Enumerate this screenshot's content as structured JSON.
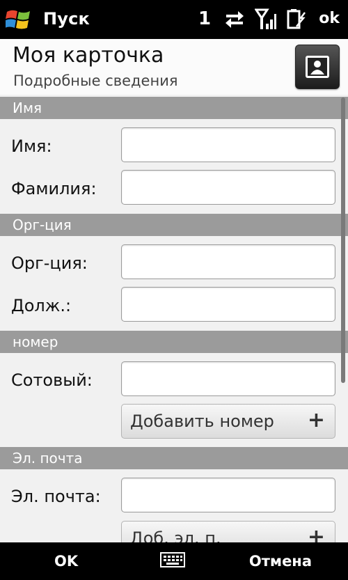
{
  "status_bar": {
    "start_label": "Пуск",
    "unread_count": "1",
    "ok_label": "ok"
  },
  "header": {
    "title": "Моя карточка",
    "subtitle": "Подробные сведения"
  },
  "sections": {
    "name": "Имя",
    "org": "Орг-ция",
    "number": "номер",
    "email": "Эл. почта"
  },
  "fields": {
    "first_name": {
      "label": "Имя:",
      "value": ""
    },
    "last_name": {
      "label": "Фамилия:",
      "value": ""
    },
    "organization": {
      "label": "Орг-ция:",
      "value": ""
    },
    "job_title": {
      "label": "Долж.:",
      "value": ""
    },
    "mobile": {
      "label": "Сотовый:",
      "value": ""
    },
    "email": {
      "label": "Эл. почта:",
      "value": ""
    }
  },
  "buttons": {
    "add_number": "Добавить номер",
    "add_email": "Доб. эл. п.",
    "plus": "+"
  },
  "bottom_bar": {
    "left_label": "OK",
    "right_label": "Отмена"
  }
}
